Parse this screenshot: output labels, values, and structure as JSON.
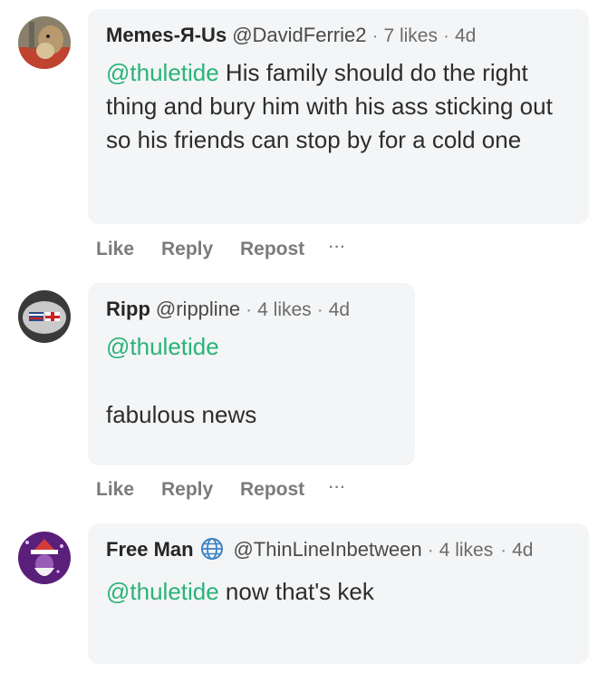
{
  "comments": [
    {
      "author": "Memes-Я-Us",
      "handle": "@DavidFerrie2",
      "likes": "7 likes",
      "age": "4d",
      "mention": "@thuletide",
      "body": " His family should do the right thing and bury him with his ass sticking out so his friends can stop by for a cold one",
      "avatar_icon": "dog-avatar"
    },
    {
      "author": "Ripp",
      "handle": "@rippline",
      "likes": "4 likes",
      "age": "4d",
      "mention": "@thuletide",
      "body": "fabulous news",
      "avatar_icon": "flag-helmet-avatar"
    },
    {
      "author": "Free Man",
      "handle": "@ThinLineInbetween",
      "likes": "4 likes",
      "age": "4d",
      "mention": "@thuletide",
      "body": " now that's kek",
      "avatar_icon": "purple-santa-avatar",
      "badge_icon": "globe-icon"
    }
  ],
  "actions": {
    "like": "Like",
    "reply": "Reply",
    "repost": "Repost",
    "more": "···"
  },
  "colors": {
    "mention": "#29b37a",
    "bubble": "#f4f5f6",
    "badge": "#3b82c4"
  }
}
